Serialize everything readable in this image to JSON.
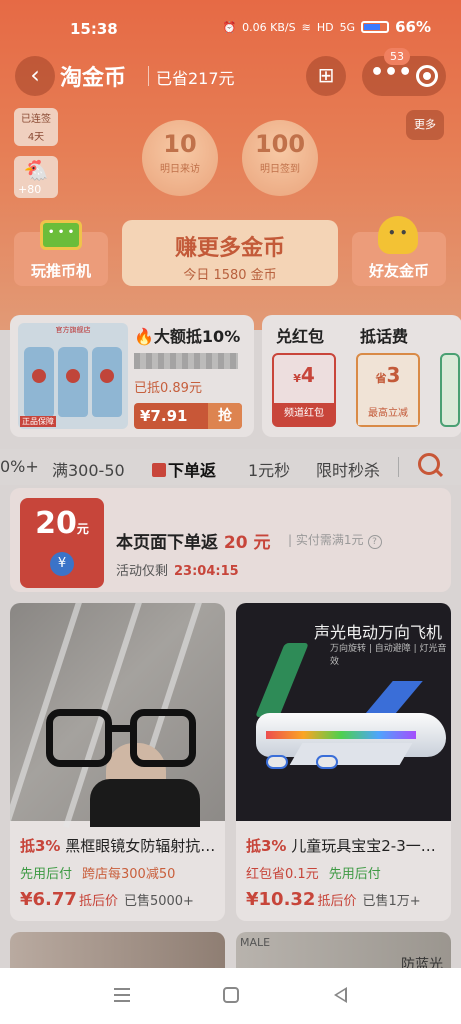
{
  "status_bar": {
    "time": "15:38",
    "net_speed": "0.06 KB/S",
    "hd": "HD",
    "signal": "5G",
    "battery": "66%"
  },
  "nav": {
    "title": "淘金币",
    "saved": "已省217元",
    "badge": "53"
  },
  "header": {
    "streak_label": "已连签",
    "streak_days": "4天",
    "chick_bonus": "+80",
    "coin_tomorrow_visit": {
      "value": "10",
      "label": "明日来访"
    },
    "coin_tomorrow_sign": {
      "value": "100",
      "label": "明日签到"
    },
    "more": "更多",
    "left_card": "玩推币机",
    "earn_title": "赚更多金币",
    "earn_sub": "今日 1580 金币",
    "right_card": "好友金币"
  },
  "deal": {
    "store_tag": "官方旗舰店",
    "quality_tag": "正品保障",
    "headline": "大额抵10%",
    "saved": "已抵0.89元",
    "price": "¥7.91",
    "grab": "抢"
  },
  "coupons": {
    "title1": "兑红包",
    "title2": "抵话费",
    "c1_value": "4",
    "c1_prefix": "¥",
    "c1_label": "频道红包",
    "c2_value": "3",
    "c2_prefix": "省",
    "c2_label": "最高立减"
  },
  "tabs": [
    "0%+",
    "满300-50",
    "下单返",
    "1元秒",
    "限时秒杀"
  ],
  "promo": {
    "amount": "20",
    "unit": "元",
    "title_a": "本页面下单返",
    "title_amt": "20 元",
    "condition": "实付需满1元",
    "countdown_label": "活动仅剩",
    "countdown": "23:04:15"
  },
  "products": [
    {
      "discount": "抵3%",
      "name": "黑框眼镜女防辐射抗…",
      "perk1": "先用后付",
      "perk2": "跨店每300减50",
      "price": "¥6.77",
      "price_tag": "抵后价",
      "sold": "已售5000+"
    },
    {
      "image_title": "声光电动万向飞机",
      "image_sub": "万向旋转 | 自动避障 | 灯光音效",
      "discount": "抵3%",
      "name": "儿童玩具宝宝2-3一…",
      "perk1": "红包省0.1元",
      "perk2": "先用后付",
      "price": "¥10.32",
      "price_tag": "抵后价",
      "sold": "已售1万+"
    }
  ],
  "peek": {
    "brand": "MALE",
    "anti_blue": "防蓝光"
  },
  "colors": {
    "accent": "#c7453a",
    "header_orange": "#e66a45",
    "green": "#3e9a44"
  }
}
